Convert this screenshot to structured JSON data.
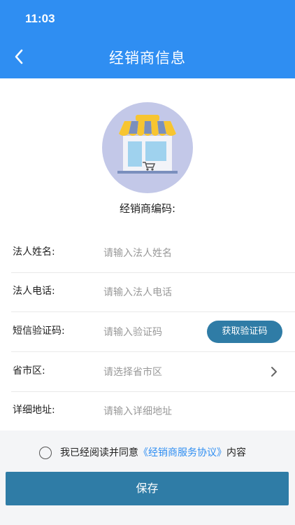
{
  "status_bar": {
    "time": "11:03"
  },
  "header": {
    "title": "经销商信息",
    "back_icon": "chevron-left-icon"
  },
  "logo": {
    "icon": "store-awning-icon"
  },
  "dealer_code": {
    "label": "经销商编码:"
  },
  "form": {
    "fields": [
      {
        "label": "法人姓名:",
        "placeholder": "请输入法人姓名"
      },
      {
        "label": "法人电话:",
        "placeholder": "请输入法人电话"
      },
      {
        "label": "短信验证码:",
        "placeholder": "请输入验证码",
        "button": "获取验证码"
      },
      {
        "label": "省市区:",
        "placeholder": "请选择省市区"
      },
      {
        "label": "详细地址:",
        "placeholder": "请输入详细地址"
      }
    ]
  },
  "agreement": {
    "prefix": "我已经阅读并同意",
    "link": "《经销商服务协议》",
    "suffix": "内容"
  },
  "save_button": "保存",
  "colors": {
    "primary": "#2f8ef2",
    "button": "#2f7ca6"
  }
}
